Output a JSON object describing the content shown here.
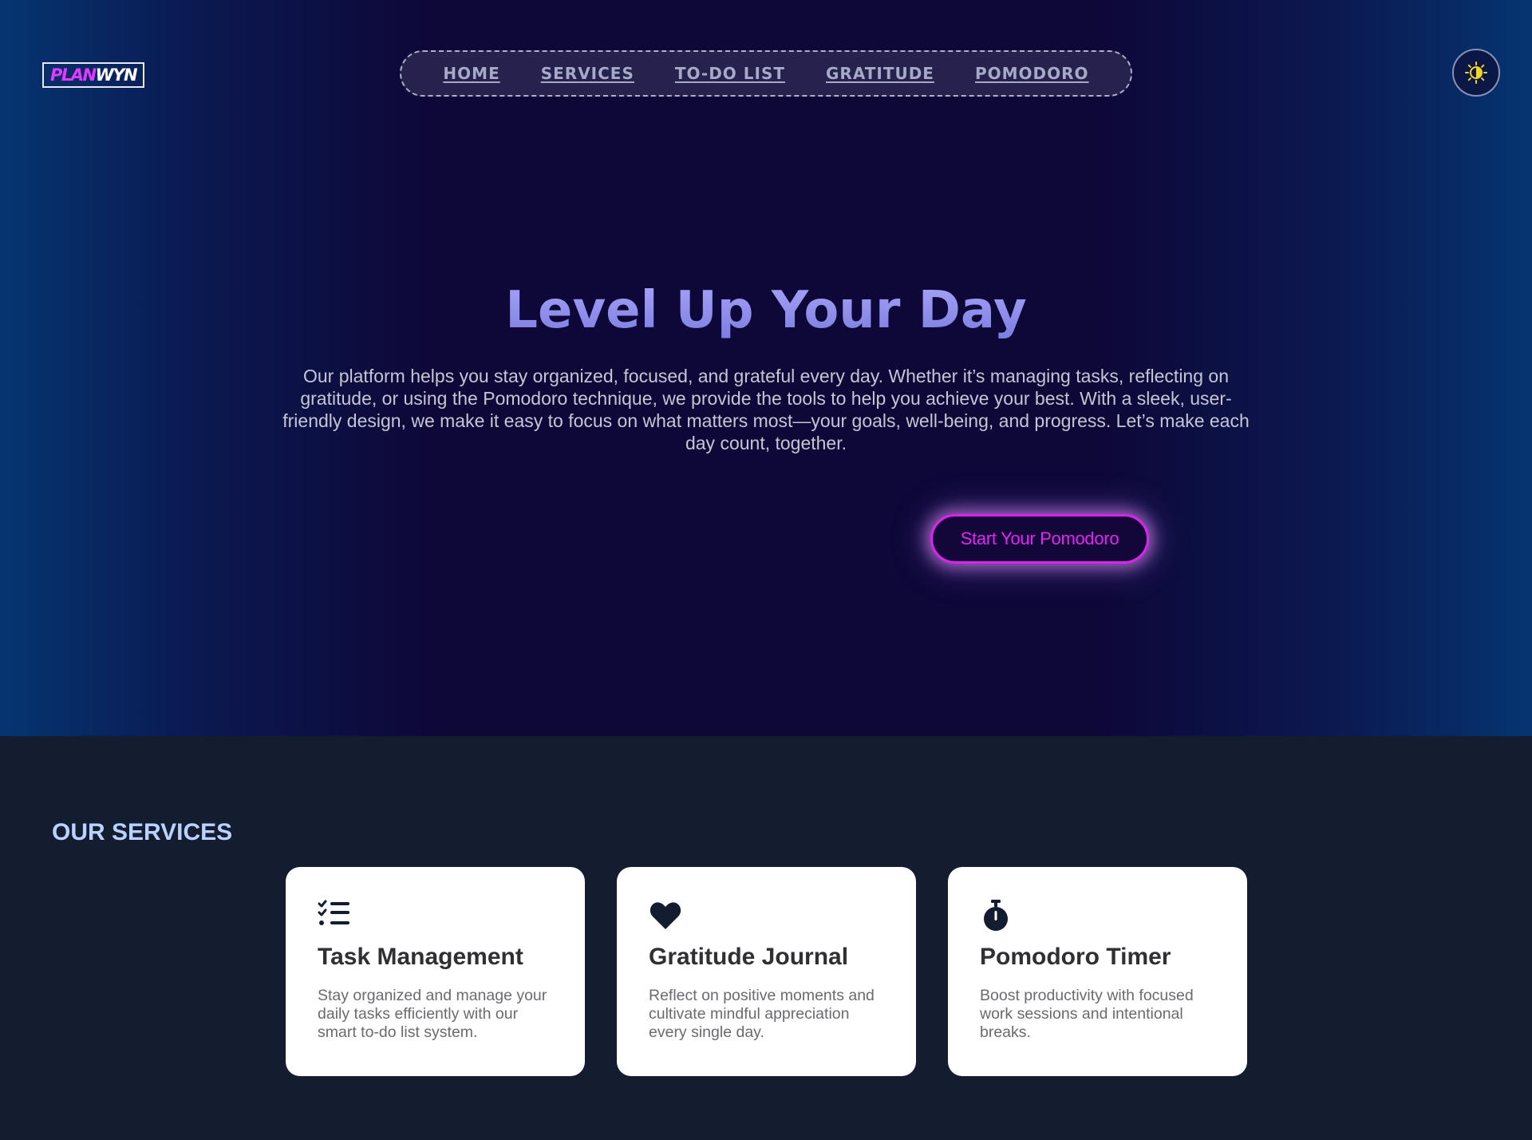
{
  "header": {
    "logo_part1": "PLAN",
    "logo_part2": "WYN",
    "nav": [
      {
        "label": "HOME"
      },
      {
        "label": "SERVICES"
      },
      {
        "label": "TO-DO LIST"
      },
      {
        "label": "GRATITUDE"
      },
      {
        "label": "POMODORO"
      }
    ],
    "theme_toggle_icon": "sun-moon-icon"
  },
  "hero": {
    "title": "Level Up Your Day",
    "description": "Our platform helps you stay organized, focused, and grateful every day. Whether it’s managing tasks, reflecting on gratitude, or using the Pomodoro technique, we provide the tools to help you achieve your best. With a sleek, user-friendly design, we make it easy to focus on what matters most—your goals, well-being, and progress. Let’s make each day count, together.",
    "cta_label": "Start Your Pomodoro"
  },
  "services": {
    "title": "OUR SERVICES",
    "cards": [
      {
        "icon": "checklist-icon",
        "title": "Task Management",
        "text": "Stay organized and manage your daily tasks efficiently with our smart to-do list system."
      },
      {
        "icon": "heart-icon",
        "title": "Gratitude Journal",
        "text": "Reflect on positive moments and cultivate mindful appreciation every single day."
      },
      {
        "icon": "stopwatch-icon",
        "title": "Pomodoro Timer",
        "text": "Boost productivity with focused work sessions and intentional breaks."
      }
    ]
  },
  "colors": {
    "accent": "#e524f4",
    "title": "#8f8ef0",
    "services_title": "#b9d2ff",
    "icon": "#141c30"
  }
}
